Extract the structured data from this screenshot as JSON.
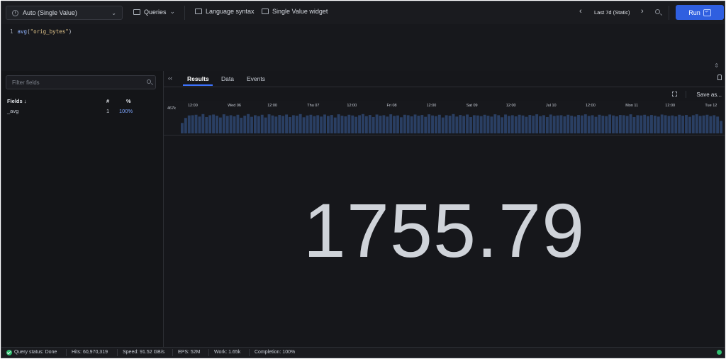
{
  "toolbar": {
    "mode_select_value": "Auto (Single Value)",
    "queries_label": "Queries",
    "language_syntax_label": "Language syntax",
    "widget_label": "Single Value widget",
    "time_range": "Last 7d (Static)",
    "run_label": "Run"
  },
  "editor": {
    "line_number": "1",
    "function": "avg",
    "open": "(",
    "argument": "\"orig_bytes\"",
    "close": ")"
  },
  "fields_panel": {
    "filter_placeholder": "Filter fields",
    "header_fields": "Fields ↓",
    "header_count": "#",
    "header_percent": "%",
    "rows": [
      {
        "name": "_avg",
        "count": "1",
        "percent": "100%"
      }
    ]
  },
  "results": {
    "tabs": [
      "Results",
      "Data",
      "Events"
    ],
    "save_as_label": "Save as...",
    "value": "1755.79"
  },
  "histogram": {
    "y_max_label": "467k",
    "tick_labels": [
      "12:00",
      "Wed 06",
      "12:00",
      "Thu 07",
      "12:00",
      "Fri 08",
      "12:00",
      "Sat 09",
      "12:00",
      "Jul 10",
      "12:00",
      "Mon 11",
      "12:00",
      "Tue 12"
    ],
    "bar_color": "#2a3f63",
    "bar_values": [
      0.46,
      0.68,
      0.79,
      0.8,
      0.82,
      0.74,
      0.85,
      0.72,
      0.8,
      0.83,
      0.78,
      0.7,
      0.84,
      0.77,
      0.8,
      0.75,
      0.82,
      0.69,
      0.78,
      0.85,
      0.73,
      0.8,
      0.76,
      0.82,
      0.7,
      0.84,
      0.79,
      0.74,
      0.81,
      0.77,
      0.83,
      0.72,
      0.8,
      0.78,
      0.85,
      0.71,
      0.79,
      0.82,
      0.76,
      0.8,
      0.74,
      0.83,
      0.77,
      0.81,
      0.7,
      0.84,
      0.78,
      0.75,
      0.82,
      0.79,
      0.73,
      0.8,
      0.85,
      0.76,
      0.81,
      0.72,
      0.83,
      0.78,
      0.8,
      0.74,
      0.84,
      0.77,
      0.79,
      0.71,
      0.82,
      0.8,
      0.75,
      0.83,
      0.78,
      0.81,
      0.73,
      0.84,
      0.79,
      0.76,
      0.82,
      0.7,
      0.8,
      0.78,
      0.85,
      0.74,
      0.81,
      0.77,
      0.83,
      0.72,
      0.8,
      0.79,
      0.76,
      0.82,
      0.78,
      0.74,
      0.84,
      0.8,
      0.71,
      0.83,
      0.77,
      0.8,
      0.75,
      0.82,
      0.79,
      0.73,
      0.81,
      0.78,
      0.84,
      0.76,
      0.8,
      0.72,
      0.83,
      0.77,
      0.79,
      0.8,
      0.75,
      0.82,
      0.78,
      0.74,
      0.81,
      0.79,
      0.84,
      0.77,
      0.8,
      0.73,
      0.82,
      0.78,
      0.76,
      0.83,
      0.79,
      0.75,
      0.81,
      0.8,
      0.77,
      0.84,
      0.72,
      0.8,
      0.79,
      0.82,
      0.76,
      0.81,
      0.78,
      0.74,
      0.83,
      0.8,
      0.77,
      0.79,
      0.75,
      0.82,
      0.78,
      0.81,
      0.73,
      0.8,
      0.84,
      0.77,
      0.79,
      0.82,
      0.76,
      0.8,
      0.74,
      0.55
    ]
  },
  "status_bar": {
    "query_status": "Query status: Done",
    "hits": "Hits: 60,970,319",
    "speed": "Speed: 91.52 GB/s",
    "eps": "EPS: 52M",
    "work": "Work: 1.65k",
    "completion": "Completion: 100%"
  }
}
